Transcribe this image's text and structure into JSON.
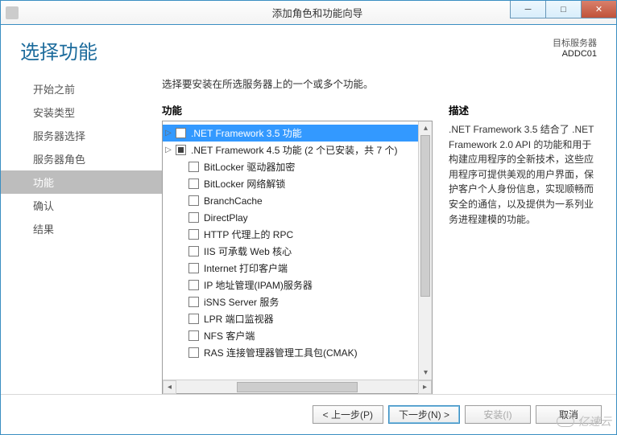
{
  "window": {
    "title": "添加角色和功能向导",
    "minimize": "─",
    "maximize": "□",
    "close": "✕"
  },
  "header": {
    "page_title": "选择功能",
    "target_server_label": "目标服务器",
    "target_server_name": "ADDC01"
  },
  "nav_steps": [
    {
      "label": "开始之前",
      "key": "before"
    },
    {
      "label": "安装类型",
      "key": "type"
    },
    {
      "label": "服务器选择",
      "key": "server"
    },
    {
      "label": "服务器角色",
      "key": "roles"
    },
    {
      "label": "功能",
      "key": "features",
      "active": true
    },
    {
      "label": "确认",
      "key": "confirm"
    },
    {
      "label": "结果",
      "key": "result"
    }
  ],
  "content": {
    "instruction": "选择要安装在所选服务器上的一个或多个功能。",
    "features_heading": "功能",
    "description_heading": "描述",
    "description_text": ".NET Framework 3.5 结合了 .NET Framework 2.0 API 的功能和用于构建应用程序的全新技术，这些应用程序可提供美观的用户界面，保护客户个人身份信息，实现顺畅而安全的通信，以及提供为一系列业务进程建模的功能。"
  },
  "features": [
    {
      "label": ".NET Framework 3.5 功能",
      "expandable": true,
      "check": "unchecked",
      "selected": true
    },
    {
      "label": ".NET Framework 4.5 功能 (2 个已安装，共 7 个)",
      "expandable": true,
      "check": "partial"
    },
    {
      "label": "BitLocker 驱动器加密",
      "check": "unchecked"
    },
    {
      "label": "BitLocker 网络解锁",
      "check": "unchecked"
    },
    {
      "label": "BranchCache",
      "check": "unchecked"
    },
    {
      "label": "DirectPlay",
      "check": "unchecked"
    },
    {
      "label": "HTTP 代理上的 RPC",
      "check": "unchecked"
    },
    {
      "label": "IIS 可承载 Web 核心",
      "check": "unchecked"
    },
    {
      "label": "Internet 打印客户端",
      "check": "unchecked"
    },
    {
      "label": "IP 地址管理(IPAM)服务器",
      "check": "unchecked"
    },
    {
      "label": "iSNS Server 服务",
      "check": "unchecked"
    },
    {
      "label": "LPR 端口监视器",
      "check": "unchecked"
    },
    {
      "label": "NFS 客户端",
      "check": "unchecked"
    },
    {
      "label": "RAS 连接管理器管理工具包(CMAK)",
      "check": "unchecked"
    }
  ],
  "footer": {
    "prev": "< 上一步(P)",
    "next": "下一步(N) >",
    "install": "安装(I)",
    "cancel": "取消"
  },
  "watermark": "亿速云"
}
